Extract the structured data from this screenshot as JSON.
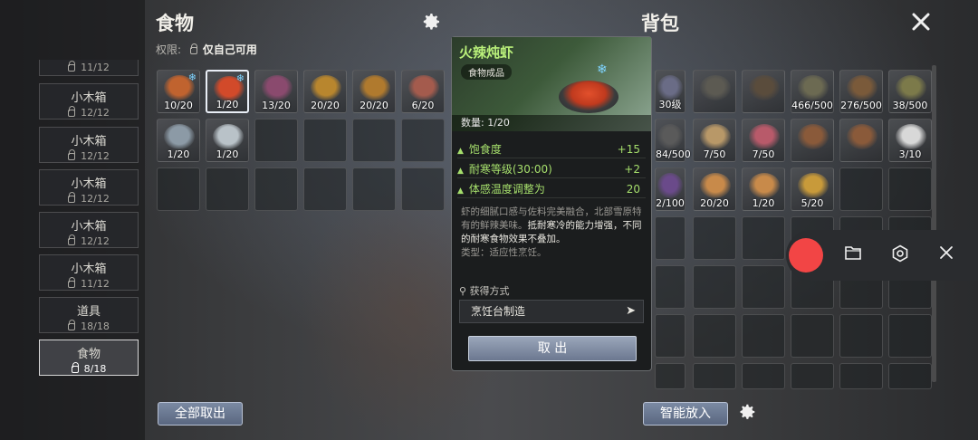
{
  "left_panel": {
    "title": "食物",
    "permission_label": "权限:",
    "permission_value": "仅自己可用",
    "storage_top_partial": "11/12",
    "storage": [
      {
        "name": "小木箱",
        "count": "12/12"
      },
      {
        "name": "小木箱",
        "count": "12/12"
      },
      {
        "name": "小木箱",
        "count": "12/12"
      },
      {
        "name": "小木箱",
        "count": "12/12"
      },
      {
        "name": "小木箱",
        "count": "11/12"
      },
      {
        "name": "道具",
        "count": "18/18"
      },
      {
        "name": "食物",
        "count": "8/18"
      }
    ],
    "slots": [
      {
        "qty": "10/20",
        "frozen": true,
        "color": "#c0632f"
      },
      {
        "qty": "1/20",
        "frozen": true,
        "color": "#d24a2a",
        "selected": true
      },
      {
        "qty": "13/20",
        "frozen": false,
        "color": "#8a4a6e"
      },
      {
        "qty": "20/20",
        "frozen": false,
        "color": "#b8862e"
      },
      {
        "qty": "20/20",
        "frozen": false,
        "color": "#b07a2e"
      },
      {
        "qty": "6/20",
        "frozen": false,
        "color": "#a45b4d"
      },
      {
        "qty": "1/20",
        "frozen": false,
        "color": "#8c9aa6"
      },
      {
        "qty": "1/20",
        "frozen": false,
        "color": "#b9c2c8"
      }
    ],
    "take_all_label": "全部取出"
  },
  "tooltip": {
    "name": "火辣炖虾",
    "tag": "食物成品",
    "quantity": "数量: 1/20",
    "stats": [
      {
        "label": "饱食度",
        "value": "+15"
      },
      {
        "label": "耐寒等级(30:00)",
        "value": "+2"
      },
      {
        "label": "体感温度调整为",
        "value": "20"
      }
    ],
    "desc_normal": "虾的细腻口感与佐料完美融合，北部雪原特有的鲜辣美味。",
    "desc_highlight": "抵耐寒冷的能力增强，不同的耐寒食物效果不叠加。",
    "type_text": "类型：适应性烹饪。",
    "source_label": "获得方式",
    "source_value": "烹饪台制造",
    "cancel_label": "取 出"
  },
  "right_panel": {
    "title": "背包",
    "slots": [
      {
        "qty": "30级",
        "color": "#6a6c86"
      },
      {
        "qty": "",
        "color": "#5c5a52"
      },
      {
        "qty": "",
        "color": "#5a4c3c"
      },
      {
        "qty": "466/500",
        "color": "#6c6a52"
      },
      {
        "qty": "276/500",
        "color": "#7a5a3a"
      },
      {
        "qty": "38/500",
        "color": "#7c7a4a"
      },
      {
        "qty": "84/500",
        "color": "#5a5a5a"
      },
      {
        "qty": "7/50",
        "color": "#b89868"
      },
      {
        "qty": "7/50",
        "color": "#b85a6a"
      },
      {
        "qty": "",
        "color": "#8a5a3a"
      },
      {
        "qty": "",
        "color": "#8a5a3a"
      },
      {
        "qty": "3/10",
        "color": "#d8d8d8"
      },
      {
        "qty": "2/100",
        "color": "#6a4a8a"
      },
      {
        "qty": "20/20",
        "color": "#c88a4a"
      },
      {
        "qty": "1/20",
        "color": "#c88a4a"
      },
      {
        "qty": "5/20",
        "color": "#c89a3a"
      }
    ],
    "smart_store_label": "智能放入"
  },
  "icons": {
    "settings": "gear-icon",
    "close": "close-icon",
    "record": "record-icon",
    "folder": "folder-icon",
    "hexagon": "hexagon-settings-icon"
  },
  "colors": {
    "accent_green": "#a6df6c",
    "item_name": "#b9ef7a",
    "record_red": "#f24545",
    "frozen_blue": "#7fd4ff"
  }
}
